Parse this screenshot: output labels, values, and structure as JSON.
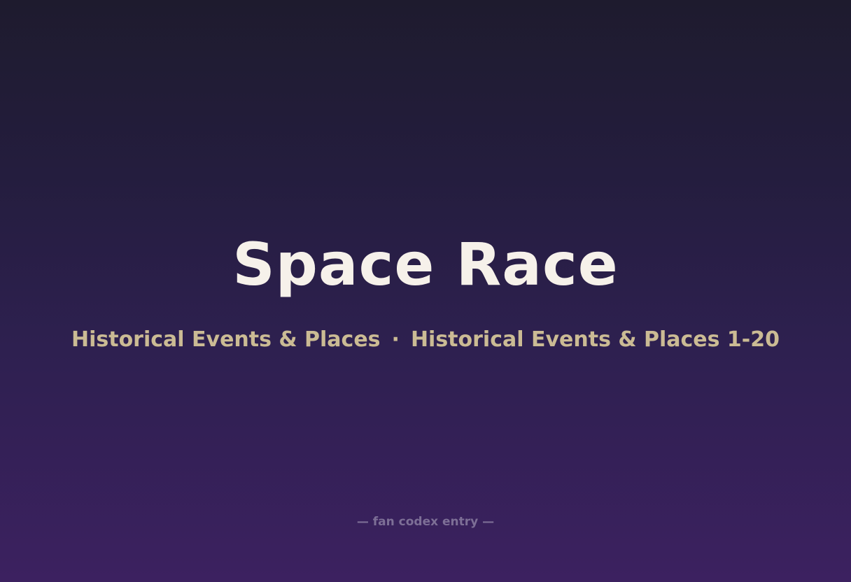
{
  "title": "Space Race",
  "subtitle": {
    "category": "Historical Events & Places",
    "separator": "·",
    "collection": "Historical Events & Places 1-20"
  },
  "footer": "— fan codex entry —",
  "colors": {
    "title": "#f6f1ea",
    "subtitle": "#cbbb94",
    "footer": "#7d6f96",
    "background_top": "#1e1b2e",
    "background_bottom": "#3c2160"
  }
}
